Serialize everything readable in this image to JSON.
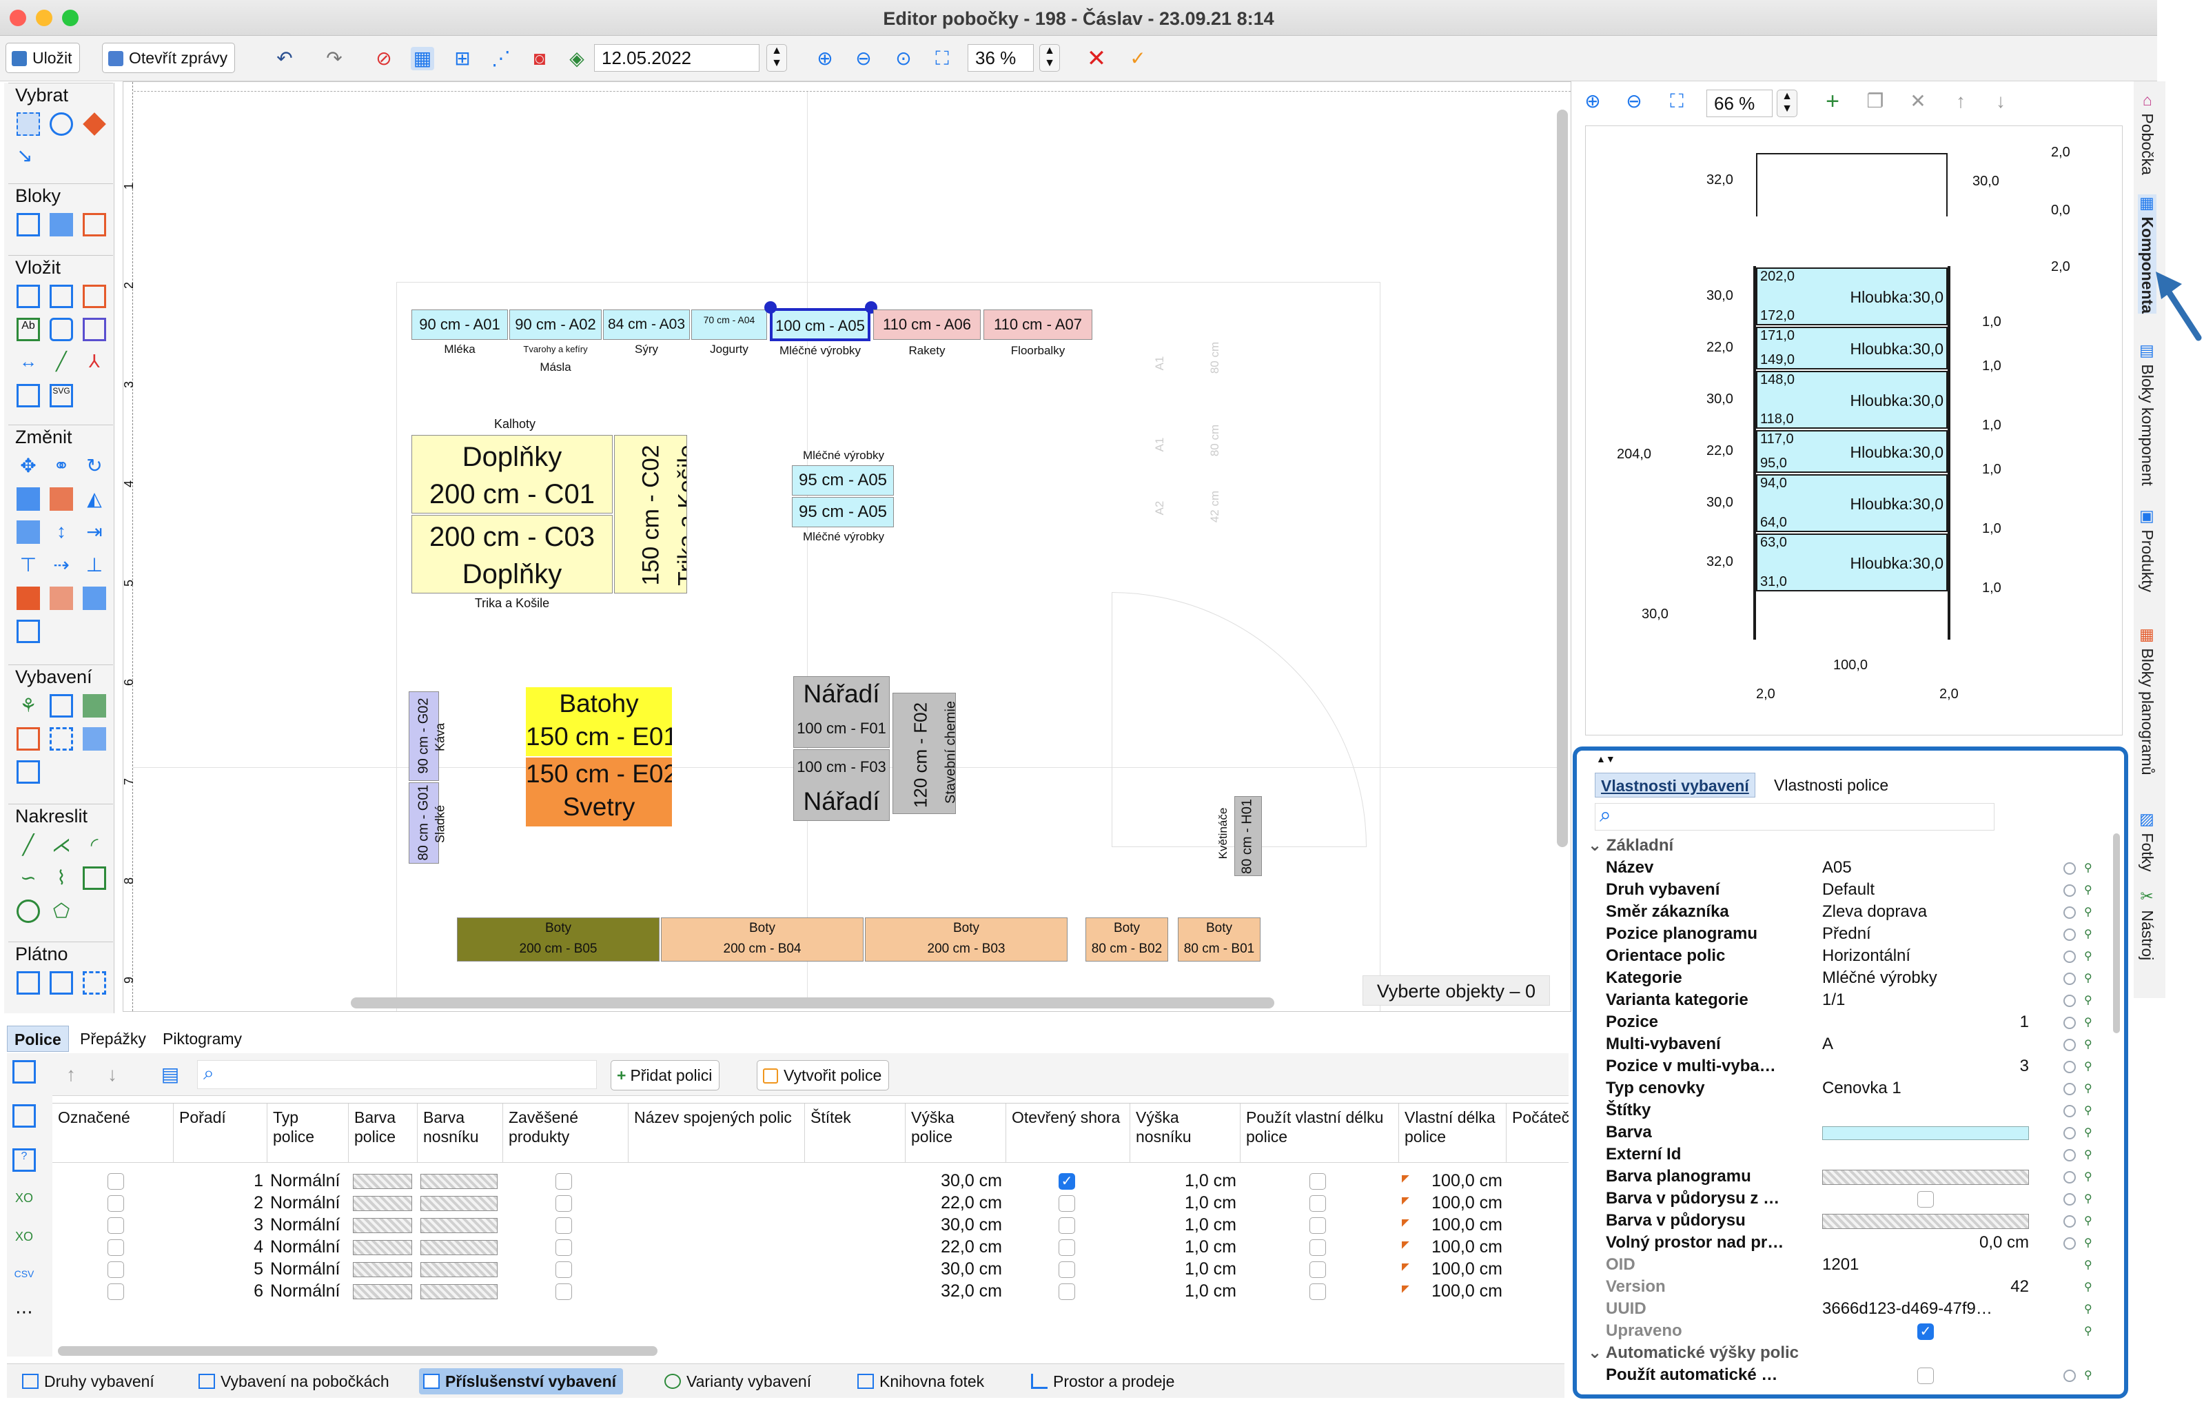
{
  "window": {
    "title": "Editor pobočky - 198 - Čáslav - 23.09.21 8:14"
  },
  "toolbar": {
    "save": "Uložit",
    "open_reports": "Otevřít zprávy",
    "date": "12.05.2022",
    "zoom": "36 %"
  },
  "palette": {
    "groups": [
      "Vybrat",
      "Bloky",
      "Vložit",
      "Změnit",
      "Vybavení",
      "Nakreslit",
      "Plátno"
    ]
  },
  "ruler": {
    "v_ticks": [
      "1",
      "2",
      "3",
      "4",
      "5",
      "6",
      "7",
      "8",
      "9"
    ]
  },
  "canvas": {
    "top_row": [
      {
        "id": "A01",
        "label": "90 cm - A01",
        "sub": "Mléka"
      },
      {
        "id": "A02",
        "label": "90 cm - A02",
        "sub": "Tvarohy a kefíry",
        "sub2": "Másla"
      },
      {
        "id": "A03",
        "label": "84 cm - A03",
        "sub": "Sýry"
      },
      {
        "id": "A04",
        "label": "70 cm - A04",
        "sub": "Jogurty"
      },
      {
        "id": "A05",
        "label": "100 cm - A05",
        "sub": "Mléčné výrobky"
      },
      {
        "id": "A06",
        "label": "110 cm - A06",
        "sub": "Rakety"
      },
      {
        "id": "A07",
        "label": "110 cm - A07",
        "sub": "Floorbalky"
      }
    ],
    "c_block": {
      "top_label": "Kalhoty",
      "c01_name": "Doplňky",
      "c01": "200 cm - C01",
      "c03": "200 cm - C03",
      "c03_name": "Doplňky",
      "bottom_label": "Trika a Košile",
      "c02": "150 cm - C02",
      "c02_name": "Trika a Košile"
    },
    "a05_island": {
      "top": "Mléčné výrobky",
      "r1": "95 cm - A05",
      "r2": "95 cm - A05",
      "bottom": "Mléčné výrobky"
    },
    "e_block": {
      "e01_name": "Batohy",
      "e01": "150 cm - E01",
      "e02": "150 cm - E02",
      "e02_name": "Svetry"
    },
    "f_block": {
      "f01_name": "Nářadí",
      "f01": "100 cm - F01",
      "f03": "100 cm - F03",
      "f03_name": "Nářadí",
      "f02": "120 cm - F02",
      "f02_name": "Stavební chemie"
    },
    "g_block": {
      "g02": "90 cm - G02",
      "g02_name": "Káva",
      "g01": "80 cm - G01",
      "g01_name": "Sladké"
    },
    "h01": {
      "label": "80 cm - H01",
      "name": "Květináče"
    },
    "ghost": [
      "80 cm",
      "A1",
      "80 cm",
      "A1",
      "42 cm",
      "A2"
    ],
    "bottom_row": [
      {
        "name": "Boty",
        "label": "200 cm - B05",
        "color": "#7f7f24"
      },
      {
        "name": "Boty",
        "label": "200 cm - B04",
        "color": "#f6c79a"
      },
      {
        "name": "Boty",
        "label": "200 cm - B03",
        "color": "#f6c79a"
      },
      {
        "name": "Boty",
        "label": "80 cm - B02",
        "color": "#f6c79a"
      },
      {
        "name": "Boty",
        "label": "80 cm - B01",
        "color": "#f6c79a"
      }
    ],
    "status": "Vyberte objekty – 0"
  },
  "bottom_tabs": [
    "Police",
    "Přepážky",
    "Piktogramy"
  ],
  "grid_toolbar": {
    "add": "Přidat polici",
    "create": "Vytvořit police"
  },
  "grid": {
    "headers": [
      "Označené",
      "Pořadí",
      "Typ police",
      "Barva police",
      "Barva nosníku",
      "Zavěšené produkty",
      "Název spojených polic",
      "Štítek",
      "Výška police",
      "Otevřený shora",
      "Výška nosníku",
      "Použít vlastní délku police",
      "Vlastní délka police",
      "Počáteč"
    ],
    "rows": [
      {
        "order": "1",
        "type": "Normální",
        "height": "30,0 cm",
        "open": true,
        "beam": "1,0 cm",
        "len": "100,0 cm"
      },
      {
        "order": "2",
        "type": "Normální",
        "height": "22,0 cm",
        "open": false,
        "beam": "1,0 cm",
        "len": "100,0 cm"
      },
      {
        "order": "3",
        "type": "Normální",
        "height": "30,0 cm",
        "open": false,
        "beam": "1,0 cm",
        "len": "100,0 cm"
      },
      {
        "order": "4",
        "type": "Normální",
        "height": "22,0 cm",
        "open": false,
        "beam": "1,0 cm",
        "len": "100,0 cm"
      },
      {
        "order": "5",
        "type": "Normální",
        "height": "30,0 cm",
        "open": false,
        "beam": "1,0 cm",
        "len": "100,0 cm"
      },
      {
        "order": "6",
        "type": "Normální",
        "height": "32,0 cm",
        "open": false,
        "beam": "1,0 cm",
        "len": "100,0 cm"
      }
    ]
  },
  "bottom_bar": [
    "Druhy vybavení",
    "Vybavení na pobočkách",
    "Příslušenství vybavení",
    "Varianty vybavení",
    "Knihovna fotek",
    "Prostor a prodeje"
  ],
  "preview": {
    "zoom": "66 %",
    "top_dims": {
      "l": "32,0",
      "r": "30,0",
      "t": "2,0",
      "b": "0,0"
    },
    "cap": "2,0",
    "total": "204,0",
    "base": "30,0",
    "width": "100,0",
    "foot_l": "2,0",
    "foot_r": "2,0",
    "shelves": [
      {
        "top": "202,0",
        "bottom": "172,0",
        "depth": "Hloubka:30,0",
        "left": "30,0",
        "right": "1,0"
      },
      {
        "top": "171,0",
        "bottom": "149,0",
        "depth": "Hloubka:30,0",
        "left": "22,0",
        "right": "1,0"
      },
      {
        "top": "148,0",
        "bottom": "118,0",
        "depth": "Hloubka:30,0",
        "left": "30,0",
        "right": "1,0"
      },
      {
        "top": "117,0",
        "bottom": "95,0",
        "depth": "Hloubka:30,0",
        "left": "22,0",
        "right": "1,0"
      },
      {
        "top": "94,0",
        "bottom": "64,0",
        "depth": "Hloubka:30,0",
        "left": "30,0",
        "right": "1,0"
      },
      {
        "top": "63,0",
        "bottom": "31,0",
        "depth": "Hloubka:30,0",
        "left": "32,0",
        "right": "1,0"
      }
    ]
  },
  "props": {
    "tabs": [
      "Vlastnosti vybavení",
      "Vlastnosti police"
    ],
    "group_basic": "Základní",
    "rows": [
      {
        "k": "Název",
        "v": "A05"
      },
      {
        "k": "Druh vybavení",
        "v": "Default"
      },
      {
        "k": "Směr zákazníka",
        "v": "Zleva doprava"
      },
      {
        "k": "Pozice planogramu",
        "v": "Přední"
      },
      {
        "k": "Orientace polic",
        "v": "Horizontální"
      },
      {
        "k": "Kategorie",
        "v": "Mléčné výrobky"
      },
      {
        "k": "Varianta kategorie",
        "v": "1/1"
      },
      {
        "k": "Pozice",
        "v": "1",
        "align": "r"
      },
      {
        "k": "Multi-vybavení",
        "v": "A"
      },
      {
        "k": "Pozice v multi-vyba…",
        "v": "3",
        "align": "r"
      },
      {
        "k": "Typ cenovky",
        "v": "Cenovka 1"
      },
      {
        "k": "Štítky",
        "v": ""
      },
      {
        "k": "Barva",
        "v": "",
        "swatch": "cyan"
      },
      {
        "k": "Externí Id",
        "v": ""
      },
      {
        "k": "Barva planogramu",
        "v": "",
        "swatch": "hatch"
      },
      {
        "k": "Barva v půdorysu z …",
        "v": "",
        "swatch": "cb"
      },
      {
        "k": "Barva v půdorysu",
        "v": "",
        "swatch": "hatch"
      },
      {
        "k": "Volný prostor nad pr…",
        "v": "0,0 cm",
        "align": "r"
      },
      {
        "k": "OID",
        "v": "1201",
        "grey": true
      },
      {
        "k": "Version",
        "v": "42",
        "align": "r",
        "grey": true
      },
      {
        "k": "UUID",
        "v": "3666d123-d469-47f9…",
        "grey": true
      },
      {
        "k": "Upraveno",
        "v": "",
        "swatch": "cbon",
        "grey": true
      }
    ],
    "group_auto": "Automatické výšky polic",
    "last_row": "Použít automatické …"
  },
  "right_strip": [
    "Pobočka",
    "Komponenta",
    "Bloky komponent",
    "Produkty",
    "Bloky planogramů",
    "Fotky",
    "Nástroj"
  ],
  "colors": {
    "accent": "#1e6ec3",
    "cyan": "#c7f3fb",
    "pink": "#f4c8c8",
    "yellow": "#fffdc4",
    "gold": "#ffff33",
    "orange": "#f5923e",
    "grey": "#c0c0c0",
    "lavender": "#c7c7f3",
    "peach": "#f6c79a",
    "olive": "#7f7f24"
  }
}
